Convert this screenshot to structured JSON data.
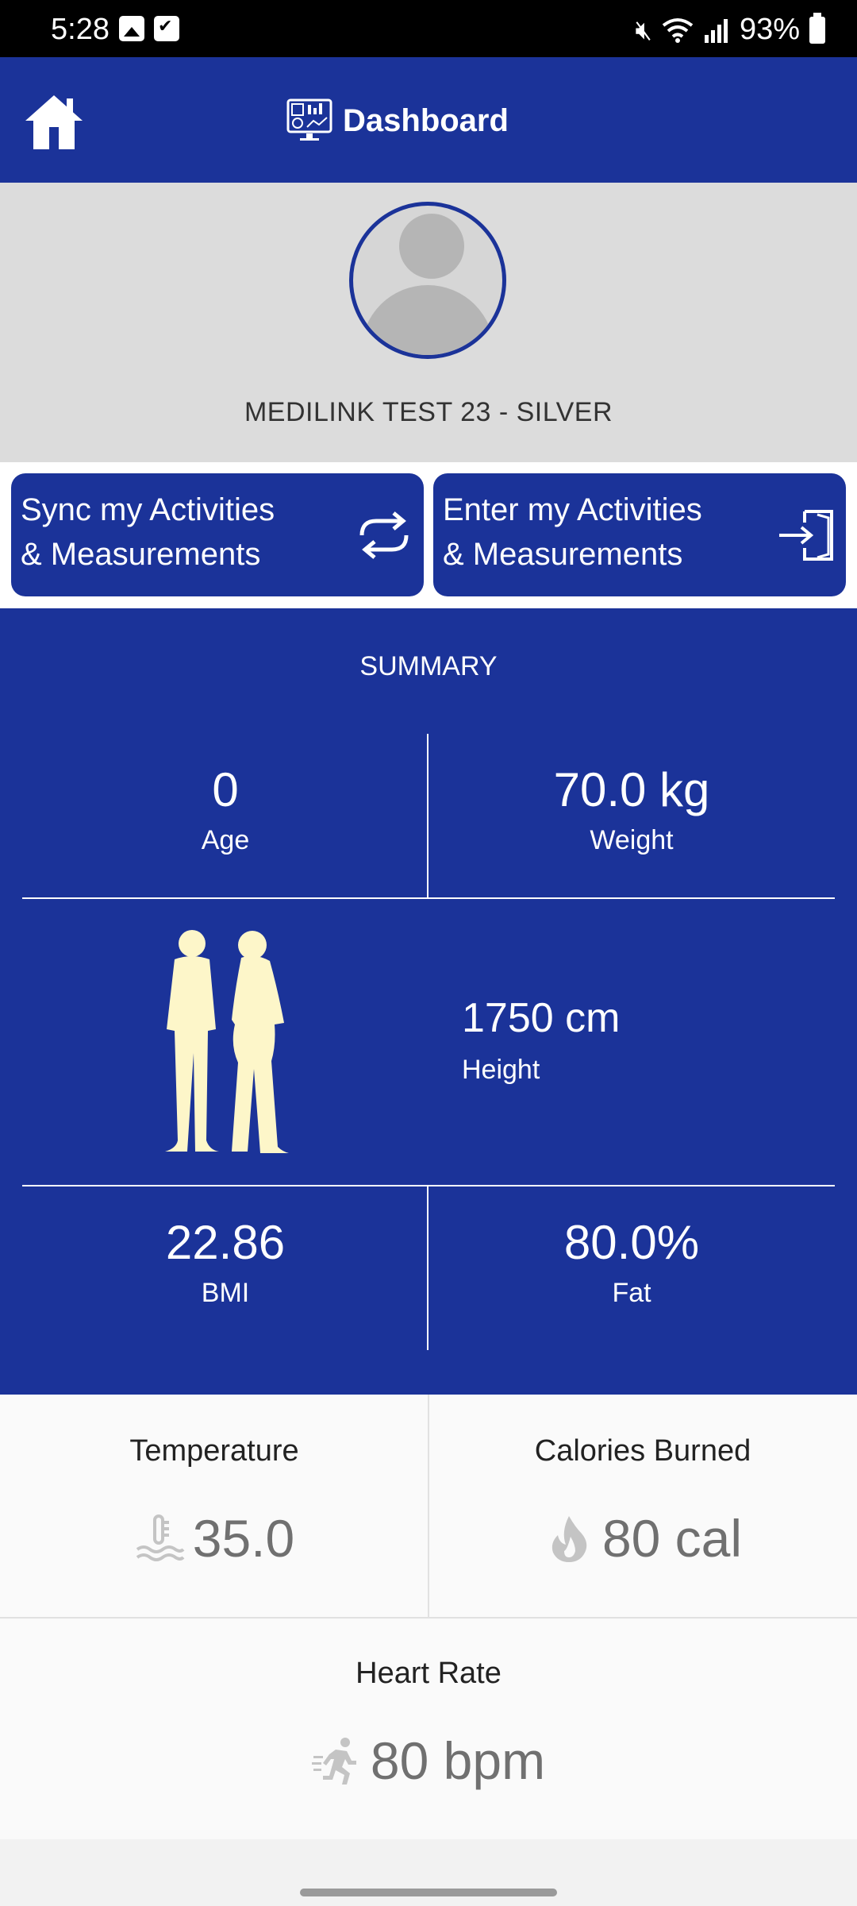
{
  "status_bar": {
    "time": "5:28",
    "battery": "93%",
    "left_icons": [
      "gallery-icon",
      "checkbox-icon"
    ],
    "right_icons": [
      "mute-icon",
      "wifi-icon",
      "signal-icon",
      "battery-icon"
    ]
  },
  "app_bar": {
    "title": "Dashboard",
    "home_icon": "home-icon",
    "title_icon": "dashboard-monitor-icon",
    "color": "#1b3399"
  },
  "profile": {
    "name": "MEDILINK TEST 23 - SILVER",
    "avatar": "default-avatar"
  },
  "actions": {
    "sync": {
      "line1": "Sync my Activities",
      "line2": "& Measurements",
      "icon": "sync-icon"
    },
    "enter": {
      "line1": "Enter my Activities",
      "line2": "& Measurements",
      "icon": "enter-icon"
    }
  },
  "summary": {
    "title": "SUMMARY",
    "age": {
      "value": "0",
      "label": "Age"
    },
    "weight": {
      "value": "70.0 kg",
      "label": "Weight"
    },
    "height": {
      "value": "1750 cm",
      "label": "Height"
    },
    "bmi": {
      "value": "22.86",
      "label": "BMI"
    },
    "fat": {
      "value": "80.0%",
      "label": "Fat"
    },
    "figure": "people-silhouette"
  },
  "metrics": {
    "temperature": {
      "label": "Temperature",
      "value": "35.0",
      "icon": "thermometer-icon"
    },
    "calories": {
      "label": "Calories Burned",
      "value": "80 cal",
      "icon": "flame-icon"
    },
    "heart_rate": {
      "label": "Heart Rate",
      "value": "80 bpm",
      "icon": "running-icon"
    }
  }
}
